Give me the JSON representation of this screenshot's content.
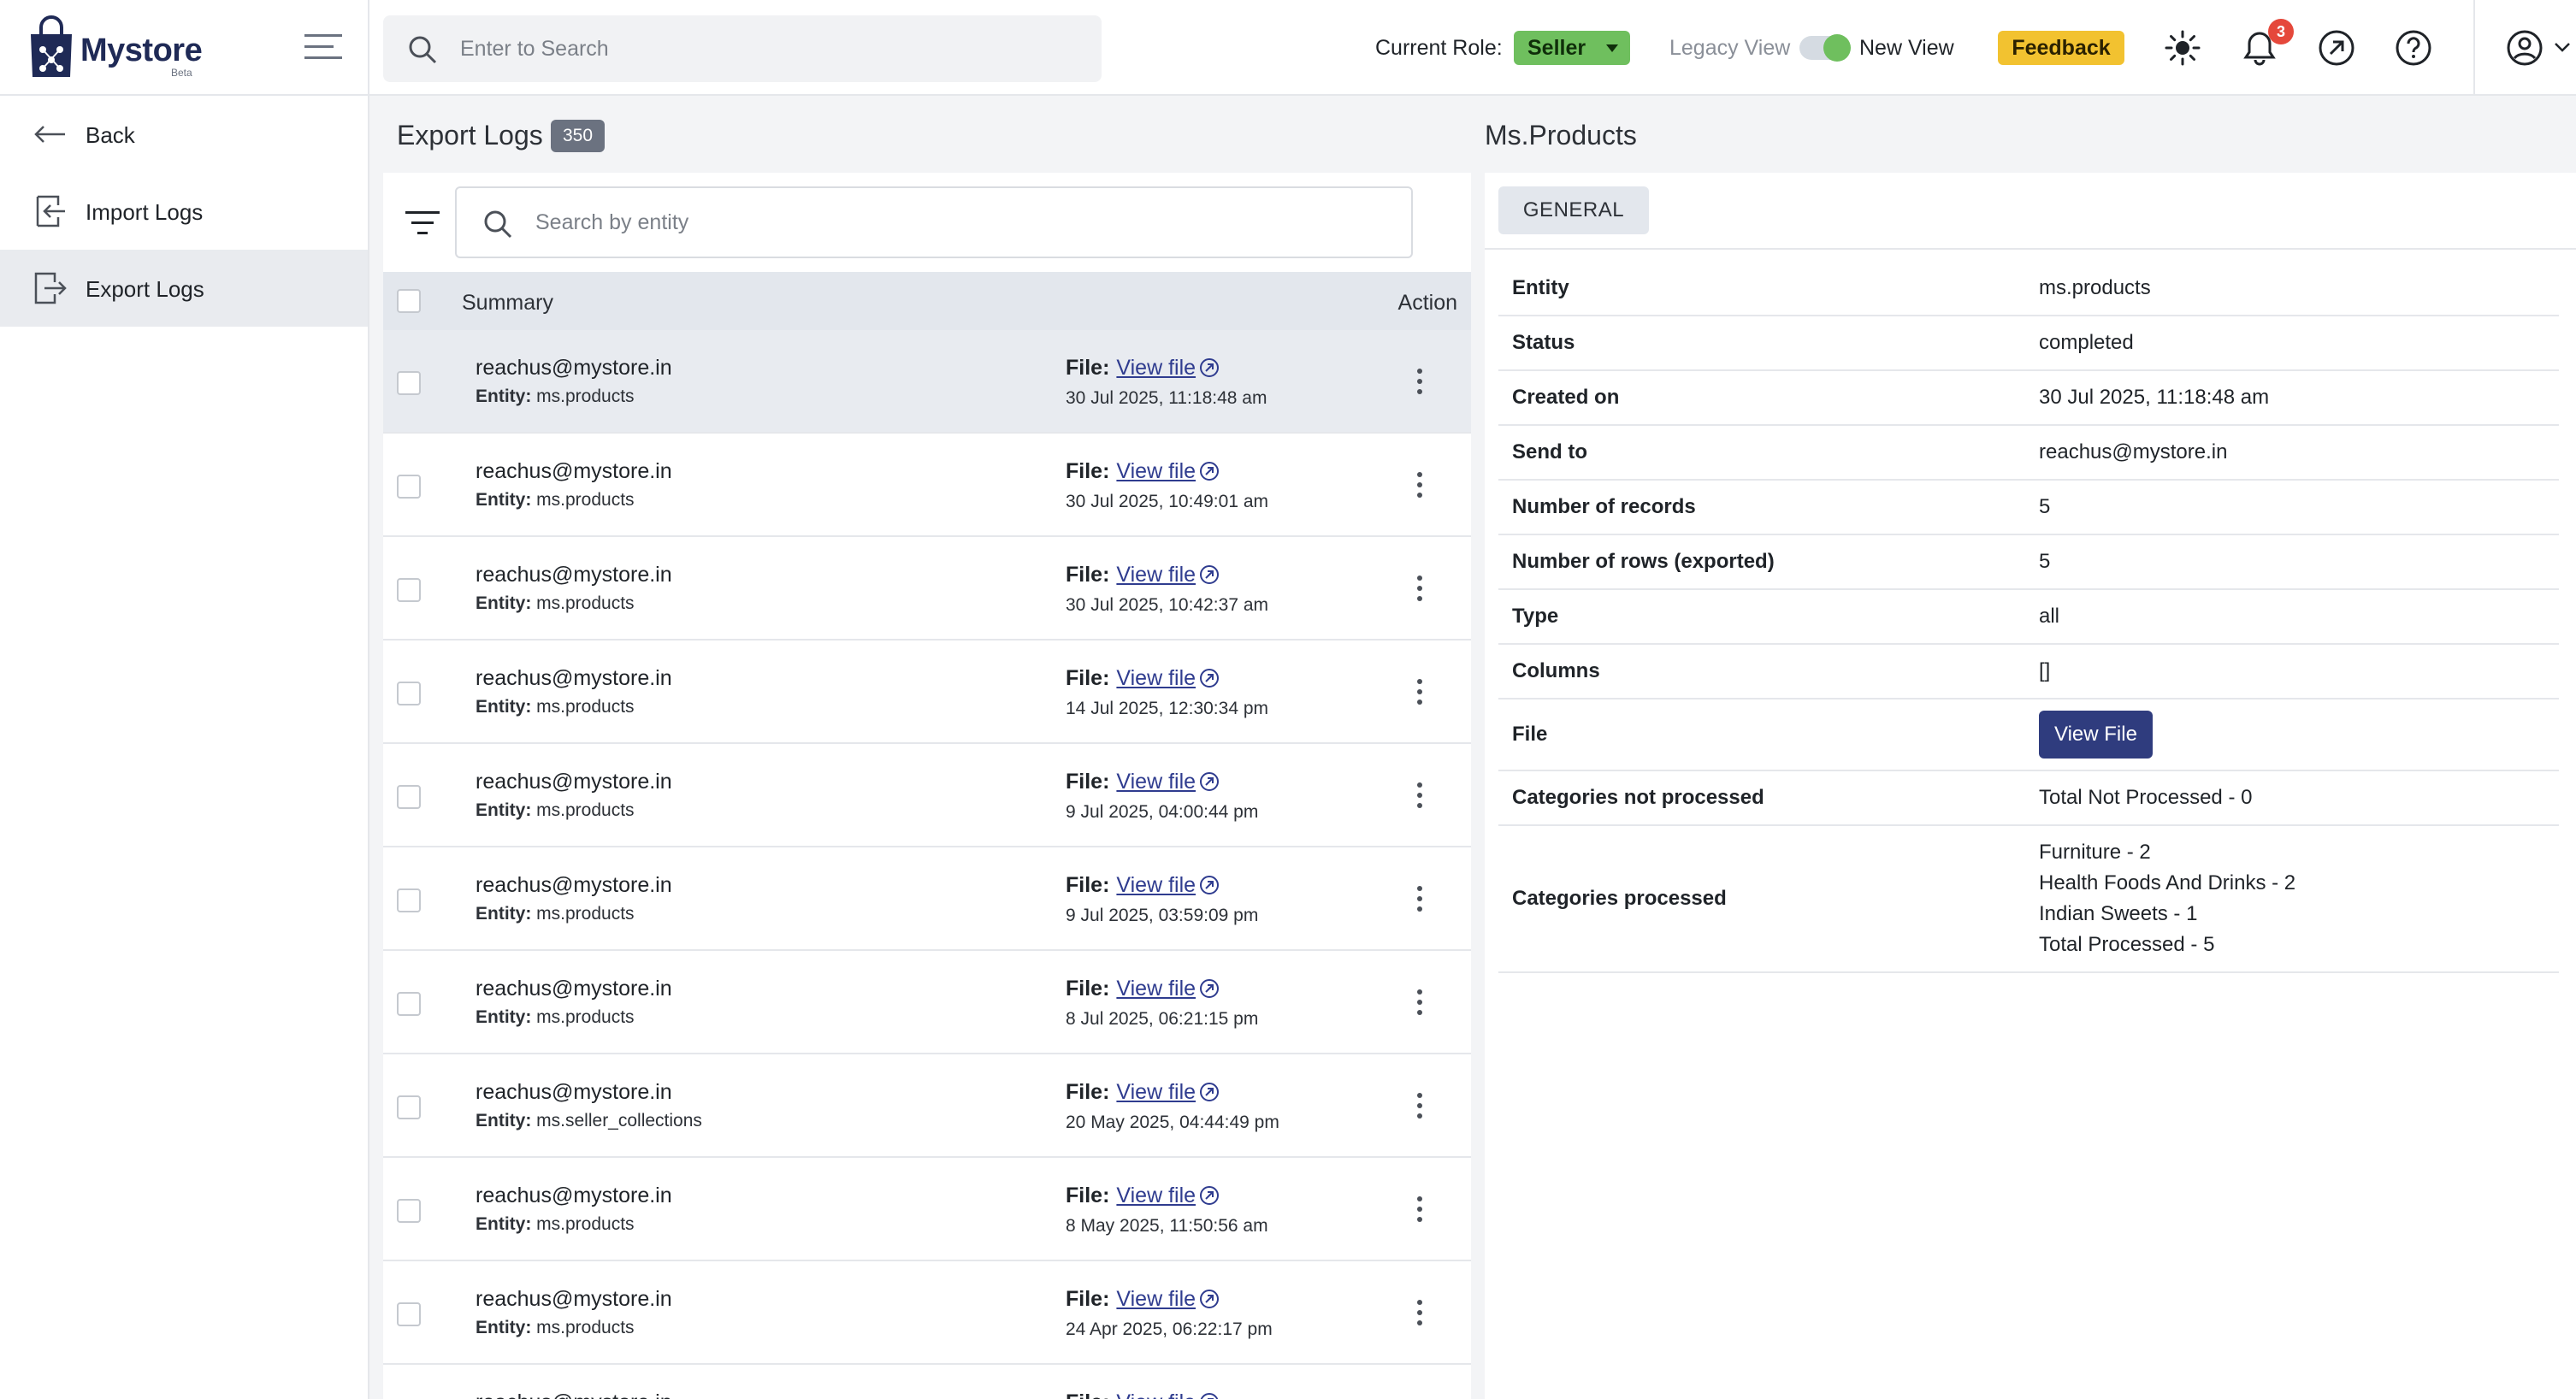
{
  "brand": {
    "name": "Mystore",
    "tag": "Beta"
  },
  "search": {
    "placeholder": "Enter to Search"
  },
  "header": {
    "role_label": "Current Role:",
    "role_value": "Seller",
    "legacy_view": "Legacy View",
    "new_view": "New View",
    "feedback": "Feedback",
    "notification_count": "3"
  },
  "sidebar": {
    "items": [
      {
        "label": "Back",
        "icon": "arrow-left-icon"
      },
      {
        "label": "Import Logs",
        "icon": "import-icon"
      },
      {
        "label": "Export Logs",
        "icon": "export-icon"
      }
    ]
  },
  "list": {
    "title": "Export Logs",
    "count": "350",
    "search_placeholder": "Search by entity",
    "col_summary": "Summary",
    "col_action": "Action",
    "file_label": "File:",
    "file_link": "View file",
    "entity_label": "Entity:",
    "rows": [
      {
        "email": "reachus@mystore.in",
        "entity": "ms.products",
        "date": "30 Jul 2025, 11:18:48 am"
      },
      {
        "email": "reachus@mystore.in",
        "entity": "ms.products",
        "date": "30 Jul 2025, 10:49:01 am"
      },
      {
        "email": "reachus@mystore.in",
        "entity": "ms.products",
        "date": "30 Jul 2025, 10:42:37 am"
      },
      {
        "email": "reachus@mystore.in",
        "entity": "ms.products",
        "date": "14 Jul 2025, 12:30:34 pm"
      },
      {
        "email": "reachus@mystore.in",
        "entity": "ms.products",
        "date": "9 Jul 2025, 04:00:44 pm"
      },
      {
        "email": "reachus@mystore.in",
        "entity": "ms.products",
        "date": "9 Jul 2025, 03:59:09 pm"
      },
      {
        "email": "reachus@mystore.in",
        "entity": "ms.products",
        "date": "8 Jul 2025, 06:21:15 pm"
      },
      {
        "email": "reachus@mystore.in",
        "entity": "ms.seller_collections",
        "date": "20 May 2025, 04:44:49 pm"
      },
      {
        "email": "reachus@mystore.in",
        "entity": "ms.products",
        "date": "8 May 2025, 11:50:56 am"
      },
      {
        "email": "reachus@mystore.in",
        "entity": "ms.products",
        "date": "24 Apr 2025, 06:22:17 pm"
      },
      {
        "email": "reachus@mystore.in",
        "entity": "",
        "date": ""
      }
    ]
  },
  "detail": {
    "title": "Ms.Products",
    "tab": "GENERAL",
    "fields": {
      "entity": {
        "label": "Entity",
        "value": "ms.products"
      },
      "status": {
        "label": "Status",
        "value": "completed"
      },
      "created_on": {
        "label": "Created on",
        "value": "30 Jul 2025, 11:18:48 am"
      },
      "send_to": {
        "label": "Send to",
        "value": "reachus@mystore.in"
      },
      "num_records": {
        "label": "Number of records",
        "value": "5"
      },
      "num_rows": {
        "label": "Number of rows (exported)",
        "value": "5"
      },
      "type": {
        "label": "Type",
        "value": "all"
      },
      "columns": {
        "label": "Columns",
        "value": "[]"
      },
      "file": {
        "label": "File",
        "button": "View File"
      },
      "cat_not_processed": {
        "label": "Categories not processed",
        "value": "Total Not Processed - 0"
      },
      "cat_processed": {
        "label": "Categories processed",
        "lines": [
          "Furniture - 2",
          "Health Foods And Drinks - 2",
          "Indian Sweets - 1",
          "Total Processed - 5"
        ]
      }
    }
  },
  "colors": {
    "brand_navy": "#1f2a56",
    "role_green": "#6fbf5e",
    "feedback_yellow": "#f2c230",
    "link_blue": "#2f3c8f",
    "button_navy": "#2f3c7e",
    "badge_red": "#e5483b"
  }
}
